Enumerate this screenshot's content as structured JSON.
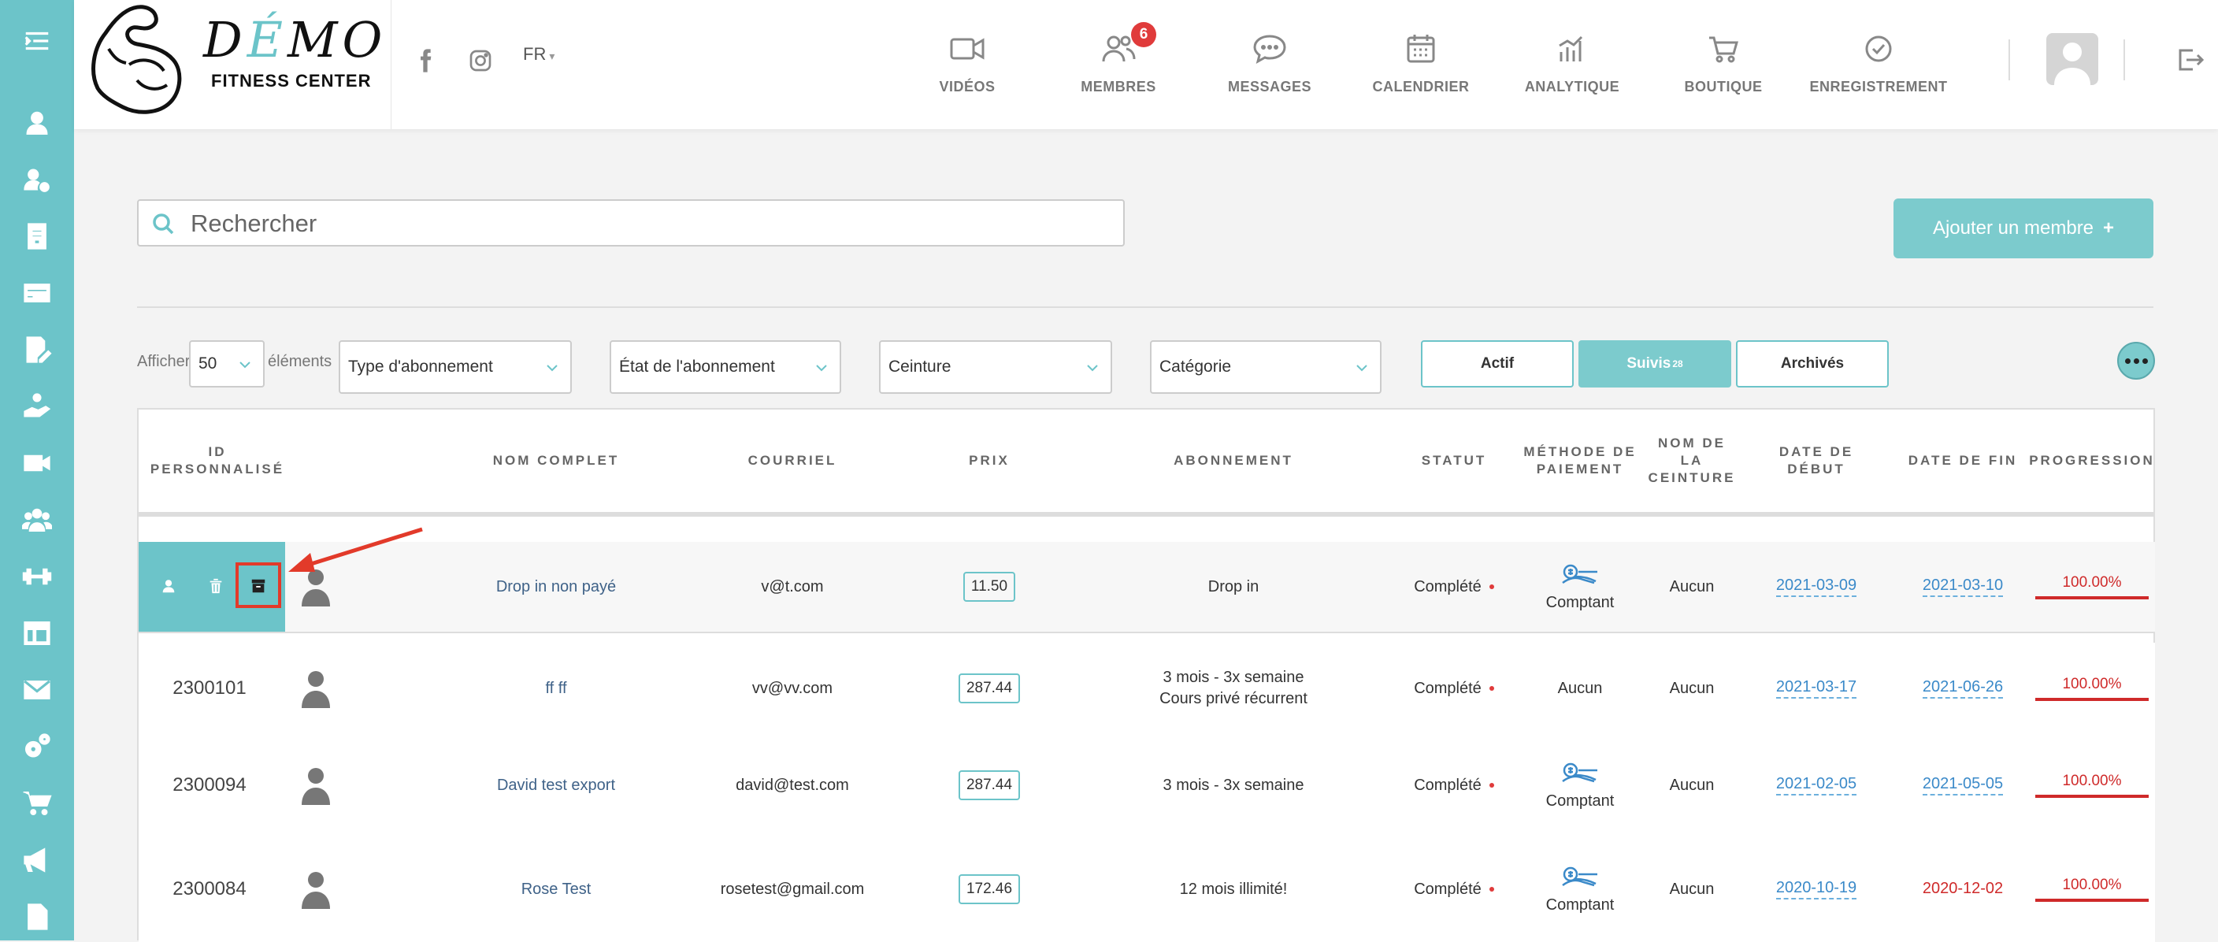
{
  "header": {
    "logo_word": "DÉMO",
    "logo_sub": "FITNESS CENTER",
    "language": "FR",
    "nav": [
      {
        "label": "VIDÉOS",
        "icon": "video-icon"
      },
      {
        "label": "MEMBRES",
        "icon": "members-icon",
        "badge": "6"
      },
      {
        "label": "MESSAGES",
        "icon": "chat-icon"
      },
      {
        "label": "CALENDRIER",
        "icon": "calendar-icon"
      },
      {
        "label": "ANALYTIQUE",
        "icon": "analytics-icon"
      },
      {
        "label": "BOUTIQUE",
        "icon": "cart-icon"
      },
      {
        "label": "ENREGISTREMENT",
        "icon": "check-circle-icon"
      }
    ]
  },
  "search": {
    "placeholder": "Rechercher"
  },
  "add_member_label": "Ajouter un membre",
  "filters": {
    "show_label": "Afficher",
    "page_size": "50",
    "elements_label": "éléments",
    "subscription_type": "Type d'abonnement",
    "subscription_state": "État de l'abonnement",
    "belt": "Ceinture",
    "category": "Catégorie",
    "tab_active": "Actif",
    "tab_followed": "Suivis",
    "tab_followed_count": "28",
    "tab_archived": "Archivés"
  },
  "table": {
    "headers": {
      "id": "ID PERSONNALISÉ",
      "name": "NOM COMPLET",
      "email": "COURRIEL",
      "price": "PRIX",
      "subscription": "ABONNEMENT",
      "status": "STATUT",
      "payment": "MÉTHODE DE PAIEMENT",
      "belt": "NOM DE LA CEINTURE",
      "start": "DATE DE DÉBUT",
      "end": "DATE DE FIN",
      "progress": "PROGRESSION"
    },
    "rows": [
      {
        "id": "",
        "name": "Drop in non payé",
        "email": "v@t.com",
        "price": "11.50",
        "sub1": "Drop in",
        "sub2": "",
        "status": "Complété",
        "payment": "Comptant",
        "belt": "Aucun",
        "start": "2021-03-09",
        "end": "2021-03-10",
        "progress": "100.00%"
      },
      {
        "id": "2300101",
        "name": "ff ff",
        "email": "vv@vv.com",
        "price": "287.44",
        "sub1": "3 mois - 3x semaine",
        "sub2": "Cours privé récurrent",
        "status": "Complété",
        "payment": "Aucun",
        "belt": "Aucun",
        "start": "2021-03-17",
        "end": "2021-06-26",
        "progress": "100.00%"
      },
      {
        "id": "2300094",
        "name": "David test export",
        "email": "david@test.com",
        "price": "287.44",
        "sub1": "3 mois - 3x semaine",
        "sub2": "",
        "status": "Complété",
        "payment": "Comptant",
        "belt": "Aucun",
        "start": "2021-02-05",
        "end": "2021-05-05",
        "progress": "100.00%"
      },
      {
        "id": "2300084",
        "name": "Rose Test",
        "email": "rosetest@gmail.com",
        "price": "172.46",
        "sub1": "12 mois illimité!",
        "sub2": "",
        "status": "Complété",
        "payment": "Comptant",
        "belt": "Aucun",
        "start": "2020-10-19",
        "end": "2020-12-02",
        "progress": "100.00%"
      }
    ]
  }
}
